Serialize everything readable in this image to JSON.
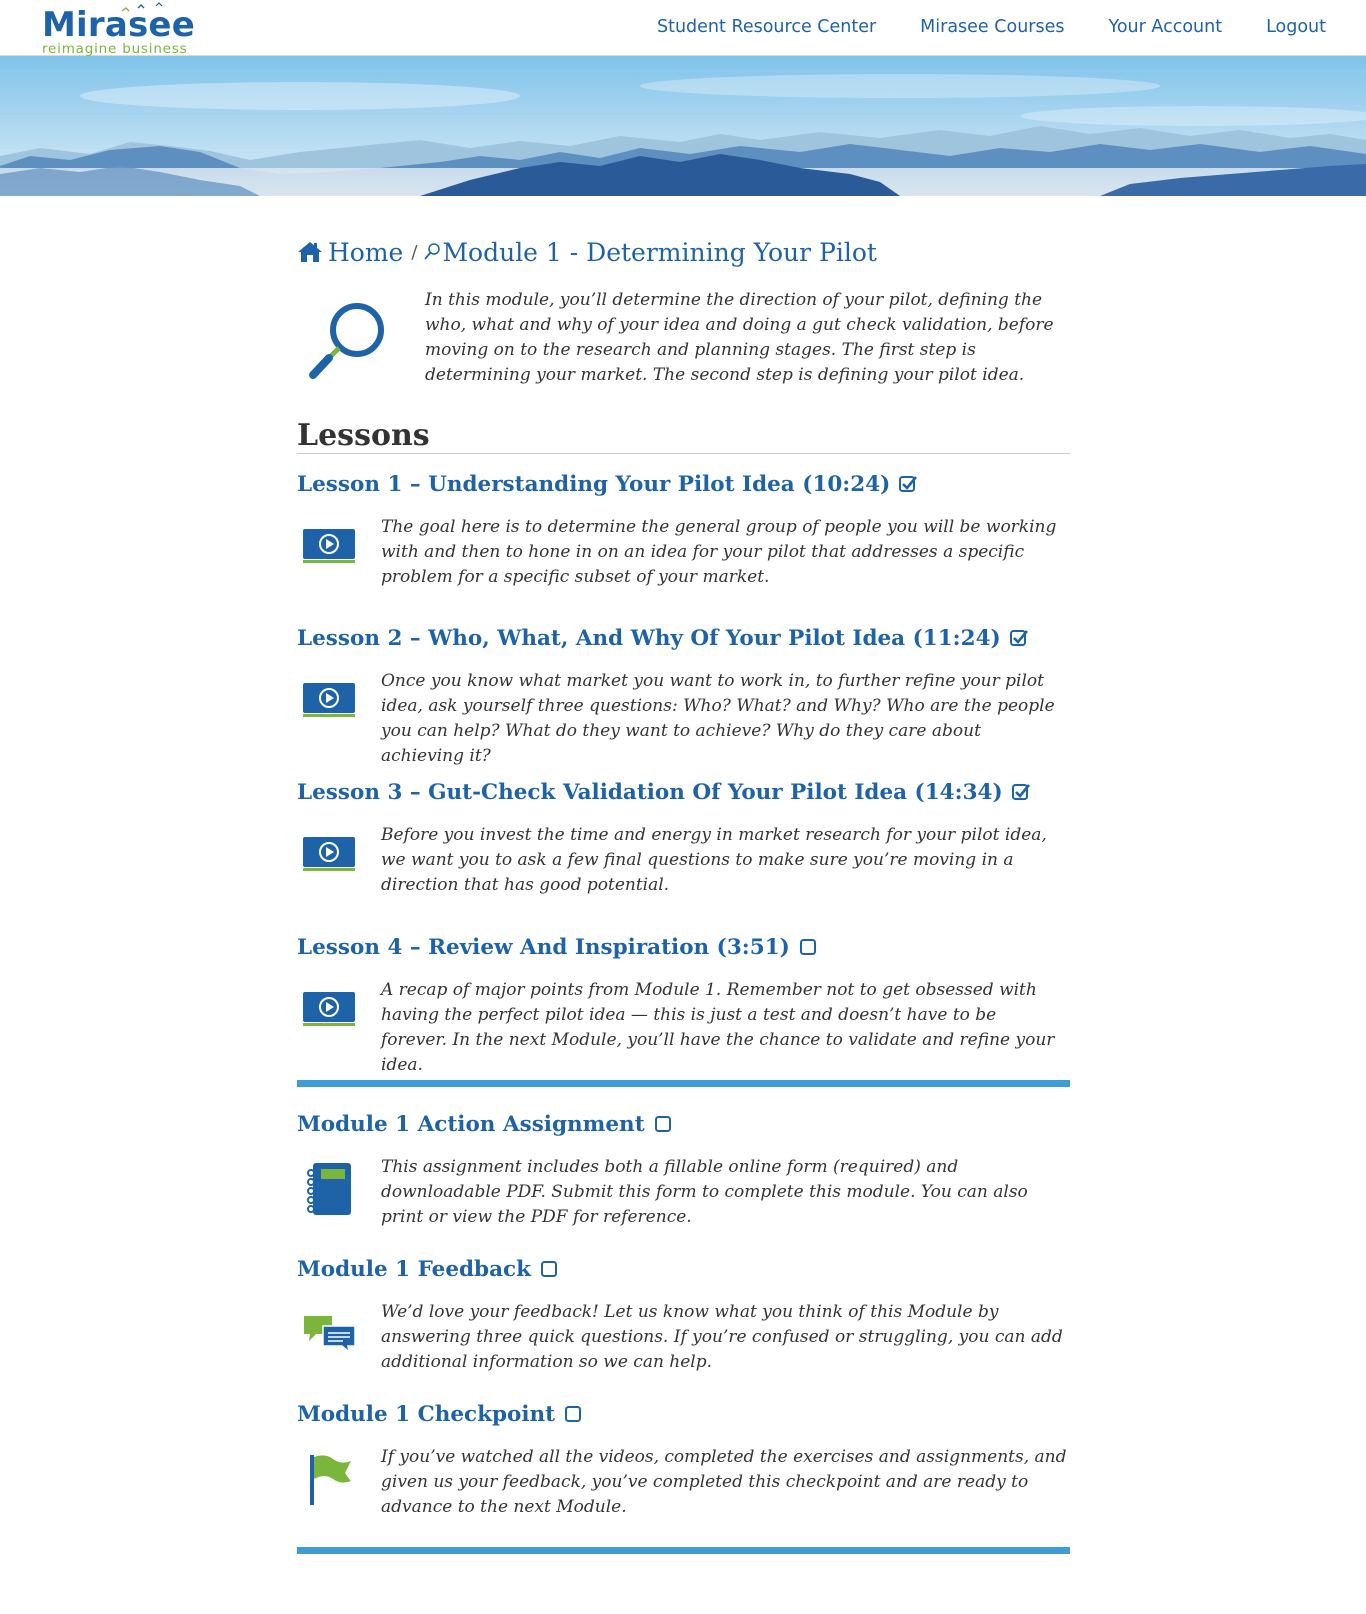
{
  "header": {
    "logo_text": "Mirasee",
    "logo_tagline": "reimagine business",
    "nav": [
      {
        "label": "Student Resource Center"
      },
      {
        "label": "Mirasee Courses"
      },
      {
        "label": "Your Account"
      },
      {
        "label": "Logout"
      }
    ]
  },
  "breadcrumb": {
    "home": "Home",
    "separator": "/",
    "current": "Module 1 - Determining Your Pilot"
  },
  "intro": {
    "icon": "magnifying-glass-icon",
    "text": "In this module, you’ll determine the direction of your pilot, defining the who, what and why of your idea and doing a gut check validation, before moving on to the research and planning stages. The first step is determining your market. The second step is defining your pilot idea."
  },
  "lessons_heading": "Lessons",
  "lessons": [
    {
      "title": "Lesson 1 – Understanding Your Pilot Idea (10:24)",
      "completed": true,
      "icon": "video-icon",
      "description": "The goal here is to determine the general group of people you will be working with and then to hone in on an idea for your pilot that addresses a specific problem for a specific subset of your market."
    },
    {
      "title": "Lesson 2 – Who, What, And Why Of Your Pilot Idea (11:24)",
      "completed": true,
      "icon": "video-icon",
      "description": "Once you know what market you want to work in, to further refine your pilot idea, ask yourself three questions: Who? What? and Why? Who are the people you can help? What do they want to achieve? Why do they care about achieving it?"
    },
    {
      "title": "Lesson 3 – Gut-Check Validation Of Your Pilot Idea (14:34)",
      "completed": true,
      "icon": "video-icon",
      "description": "Before you invest the time and energy in market research for your pilot idea, we want you to ask a few final questions to make sure you’re moving in a direction that has good potential."
    },
    {
      "title": "Lesson 4 – Review And Inspiration (3:51)",
      "completed": false,
      "icon": "video-icon",
      "description": "A recap of major points from Module 1. Remember not to get obsessed with having the perfect pilot idea — this is just a test and doesn’t have to be forever. In the next Module, you’ll have the chance to validate and refine your idea."
    }
  ],
  "extras": [
    {
      "title": "Module 1 Action Assignment",
      "completed": false,
      "icon": "notebook-icon",
      "description": "This assignment includes both a fillable online form (required) and downloadable PDF. Submit this form to complete this module. You can also print or view the PDF for reference."
    },
    {
      "title": "Module 1 Feedback",
      "completed": false,
      "icon": "chat-bubbles-icon",
      "description": "We’d love your feedback! Let us know what you think of this Module by answering three quick questions. If you’re confused or struggling, you can add additional information so we can help."
    },
    {
      "title": "Module 1 Checkpoint",
      "completed": false,
      "icon": "flag-icon",
      "description": "If you’ve watched all the videos, completed the exercises and assignments, and given us your feedback, you’ve completed this checkpoint and are ready to advance to the next Module."
    }
  ],
  "colors": {
    "brand_blue": "#1e62a8",
    "brand_green": "#7ab63c",
    "divider_blue": "#3f9cd6"
  }
}
